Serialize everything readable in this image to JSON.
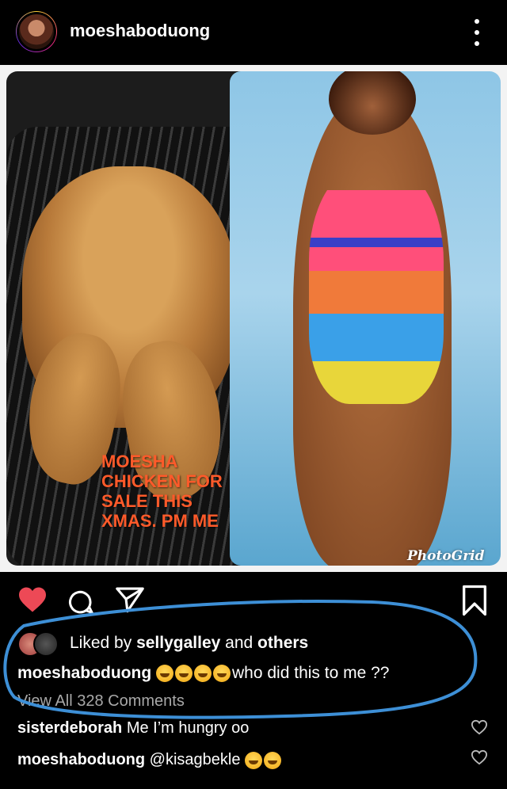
{
  "header": {
    "username": "moeshaboduong"
  },
  "post": {
    "overlay_text": "MOESHA\nCHICKEN FOR\nSALE THIS\nXMAS. PM ME",
    "watermark": "PhotoGrid"
  },
  "likes": {
    "prefix": "Liked by",
    "user": "sellygalley",
    "and": "and",
    "others": "others"
  },
  "caption": {
    "username": "moeshaboduong",
    "text": "who did this to me ??"
  },
  "view_all": "View All 328 Comments",
  "comments": [
    {
      "username": "sisterdeborah",
      "text": "Me I’m hungry oo"
    },
    {
      "username": "moeshaboduong",
      "text": "@kisagbekle"
    }
  ],
  "colors": {
    "like_red": "#ed4956",
    "annotation_blue": "#3d8fd6",
    "overlay_orange": "#ff5a2a"
  },
  "icons": [
    "more-options-icon",
    "heart-icon",
    "comment-icon",
    "share-icon",
    "bookmark-icon",
    "small-heart-icon"
  ]
}
